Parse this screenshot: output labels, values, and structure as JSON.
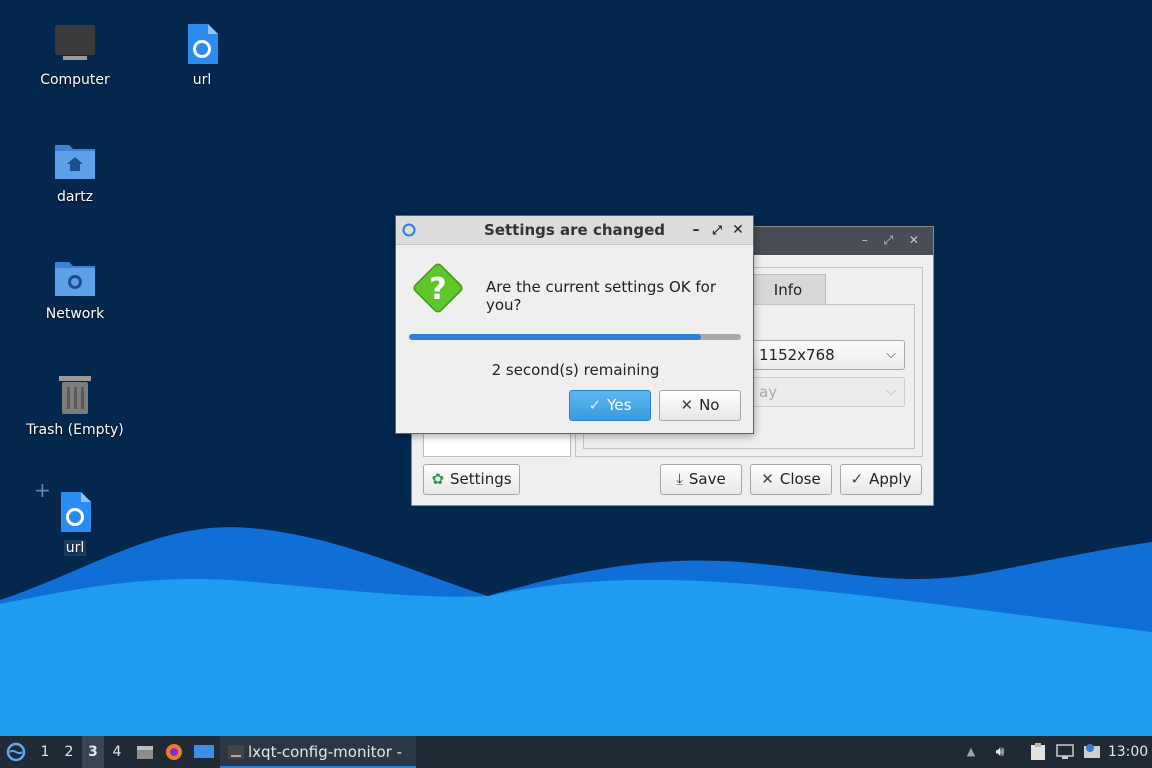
{
  "desktop": {
    "icons": [
      {
        "label": "Computer",
        "icon": "computer-icon"
      },
      {
        "label": "url",
        "icon": "web-link-icon"
      },
      {
        "label": "dartz",
        "icon": "home-folder-icon"
      },
      {
        "label": "Network",
        "icon": "network-folder-icon"
      },
      {
        "label": "Trash (Empty)",
        "icon": "trash-icon"
      },
      {
        "label": "url",
        "icon": "web-link-icon"
      }
    ]
  },
  "background_window": {
    "tab_info": "Info",
    "resolution": "1152x768",
    "secondary_combo": "ay",
    "buttons": {
      "settings": "Settings",
      "save": "Save",
      "close": "Close",
      "apply": "Apply"
    }
  },
  "dialog": {
    "title": "Settings are changed",
    "message": "Are the current settings OK for you?",
    "progress": 0.88,
    "remaining": "2 second(s) remaining",
    "yes": "Yes",
    "no": "No",
    "icon": "question-icon"
  },
  "taskbar": {
    "desktops": [
      "1",
      "2",
      "3",
      "4"
    ],
    "active_desktop": "3",
    "task_label": "lxqt-config-monitor - ...",
    "clock": "13:00"
  },
  "colors": {
    "desktop_bg": "#04274d",
    "wave_light": "#1f9bf0",
    "wave_dark": "#0f6fd6",
    "accent": "#2f7fd4",
    "question_green": "#5ec62a"
  }
}
